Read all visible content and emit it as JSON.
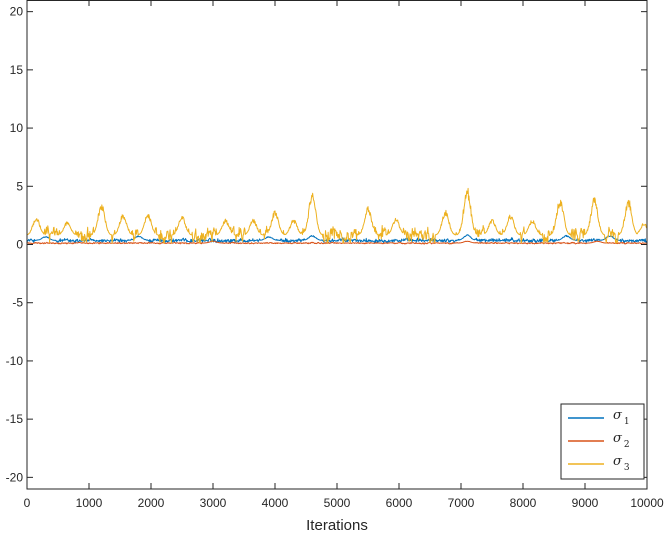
{
  "chart_data": {
    "type": "line",
    "title": "",
    "xlabel": "Iterations",
    "ylabel": "",
    "xlim": [
      0,
      10000
    ],
    "ylim": [
      -21,
      21
    ],
    "x_ticks": [
      0,
      1000,
      2000,
      3000,
      4000,
      5000,
      6000,
      7000,
      8000,
      9000,
      10000
    ],
    "y_ticks": [
      -20,
      -15,
      -10,
      -5,
      0,
      5,
      10,
      15,
      20
    ],
    "grid": false,
    "legend_position": "bottom-right",
    "n_iterations": 10000,
    "series": [
      {
        "name": "σ",
        "subscript": "1",
        "color": "#0072BD",
        "typical_value": 0.35,
        "range": [
          0.05,
          0.9
        ],
        "peaks": [
          [
            300,
            0.7
          ],
          [
            1800,
            0.75
          ],
          [
            3900,
            0.7
          ],
          [
            4600,
            0.8
          ],
          [
            7100,
            0.85
          ],
          [
            8700,
            0.8
          ],
          [
            9400,
            0.8
          ]
        ]
      },
      {
        "name": "σ",
        "subscript": "2",
        "color": "#D95319",
        "typical_value": 0.12,
        "range": [
          0.02,
          0.35
        ],
        "peaks": [
          [
            3000,
            0.3
          ],
          [
            7100,
            0.3
          ],
          [
            9200,
            0.3
          ]
        ]
      },
      {
        "name": "σ",
        "subscript": "3",
        "color": "#EDB120",
        "typical_value": 0.8,
        "range": [
          0.1,
          5.1
        ],
        "peaks": [
          [
            150,
            2.4
          ],
          [
            650,
            2.0
          ],
          [
            1200,
            3.6
          ],
          [
            1550,
            2.7
          ],
          [
            1950,
            2.7
          ],
          [
            2500,
            2.5
          ],
          [
            3200,
            2.2
          ],
          [
            3650,
            2.2
          ],
          [
            4000,
            3.0
          ],
          [
            4300,
            2.2
          ],
          [
            4600,
            4.6
          ],
          [
            5500,
            3.3
          ],
          [
            5950,
            2.3
          ],
          [
            6750,
            3.0
          ],
          [
            7100,
            5.1
          ],
          [
            7500,
            2.2
          ],
          [
            7800,
            2.6
          ],
          [
            8150,
            2.2
          ],
          [
            8600,
            4.1
          ],
          [
            9150,
            4.1
          ],
          [
            9700,
            4.0
          ],
          [
            9950,
            1.9
          ]
        ]
      }
    ]
  }
}
